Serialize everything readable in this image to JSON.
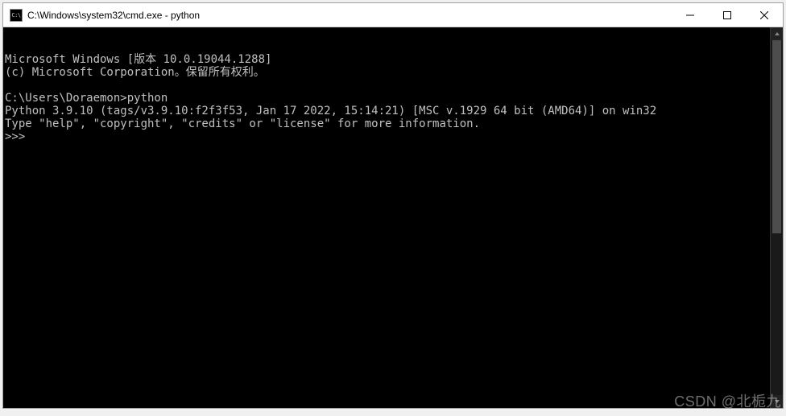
{
  "titlebar": {
    "icon_label": "C:\\",
    "title": "C:\\Windows\\system32\\cmd.exe - python"
  },
  "terminal": {
    "lines": [
      "Microsoft Windows [版本 10.0.19044.1288]",
      "(c) Microsoft Corporation。保留所有权利。",
      "",
      "C:\\Users\\Doraemon>python",
      "Python 3.9.10 (tags/v3.9.10:f2f3f53, Jan 17 2022, 15:14:21) [MSC v.1929 64 bit (AMD64)] on win32",
      "Type \"help\", \"copyright\", \"credits\" or \"license\" for more information.",
      ">>>"
    ]
  },
  "watermark": "CSDN @北栀九"
}
